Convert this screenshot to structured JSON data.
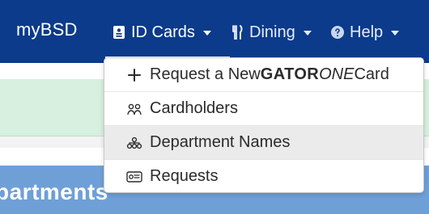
{
  "nav": {
    "brand": "myBSD",
    "items": [
      {
        "label": "ID Cards"
      },
      {
        "label": "Dining"
      },
      {
        "label": "Help"
      }
    ]
  },
  "dropdown": {
    "items": [
      {
        "text_prefix": "Request a New ",
        "text_bold": "GATOR",
        "text_italic": "ONE",
        "text_suffix": " Card",
        "icon": "plus-icon"
      },
      {
        "text": "Cardholders",
        "icon": "people-icon"
      },
      {
        "text": "Department Names",
        "icon": "org-chart-icon"
      },
      {
        "text": "Requests",
        "icon": "id-card-icon"
      }
    ]
  },
  "page": {
    "heading_fragment": "partments"
  },
  "colors": {
    "nav_bg": "#0b3b8a",
    "green_band": "#d7f0df",
    "hero_blue": "#6f9fd7",
    "active_item_bg": "#ebebeb"
  }
}
